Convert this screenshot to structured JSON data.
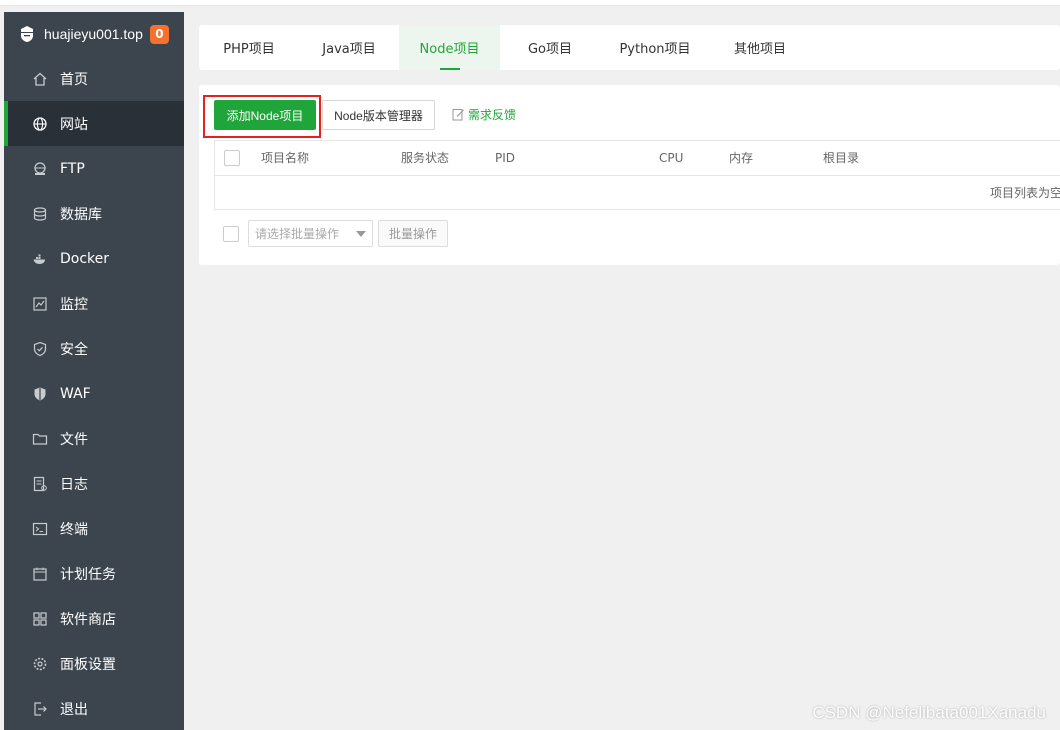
{
  "site": {
    "name": "huajieyu001.top",
    "badge": "0"
  },
  "sidebar": {
    "items": [
      {
        "label": "首页",
        "icon": "home-icon"
      },
      {
        "label": "网站",
        "icon": "globe-icon",
        "active": true
      },
      {
        "label": "FTP",
        "icon": "ftp-icon"
      },
      {
        "label": "数据库",
        "icon": "database-icon"
      },
      {
        "label": "Docker",
        "icon": "docker-icon"
      },
      {
        "label": "监控",
        "icon": "monitor-icon"
      },
      {
        "label": "安全",
        "icon": "shield-icon"
      },
      {
        "label": "WAF",
        "icon": "waf-icon"
      },
      {
        "label": "文件",
        "icon": "folder-icon"
      },
      {
        "label": "日志",
        "icon": "log-icon"
      },
      {
        "label": "终端",
        "icon": "terminal-icon"
      },
      {
        "label": "计划任务",
        "icon": "calendar-icon"
      },
      {
        "label": "软件商店",
        "icon": "apps-icon"
      },
      {
        "label": "面板设置",
        "icon": "settings-icon"
      },
      {
        "label": "退出",
        "icon": "logout-icon"
      }
    ]
  },
  "tabs": [
    {
      "label": "PHP项目"
    },
    {
      "label": "Java项目"
    },
    {
      "label": "Node项目",
      "active": true
    },
    {
      "label": "Go项目"
    },
    {
      "label": "Python项目"
    },
    {
      "label": "其他项目"
    }
  ],
  "toolbar": {
    "add_label": "添加Node项目",
    "version_label": "Node版本管理器",
    "feedback_label": "需求反馈"
  },
  "table": {
    "columns": [
      "项目名称",
      "服务状态",
      "PID",
      "CPU",
      "内存",
      "根目录"
    ],
    "empty_text": "项目列表为空"
  },
  "batch": {
    "placeholder": "请选择批量操作",
    "button_label": "批量操作"
  },
  "watermark": "CSDN @Nefelibata001Xanadu",
  "colors": {
    "accent": "#20a53a",
    "sidebar": "#3c444d",
    "badge": "#f7712e",
    "highlight": "#e3221f"
  }
}
